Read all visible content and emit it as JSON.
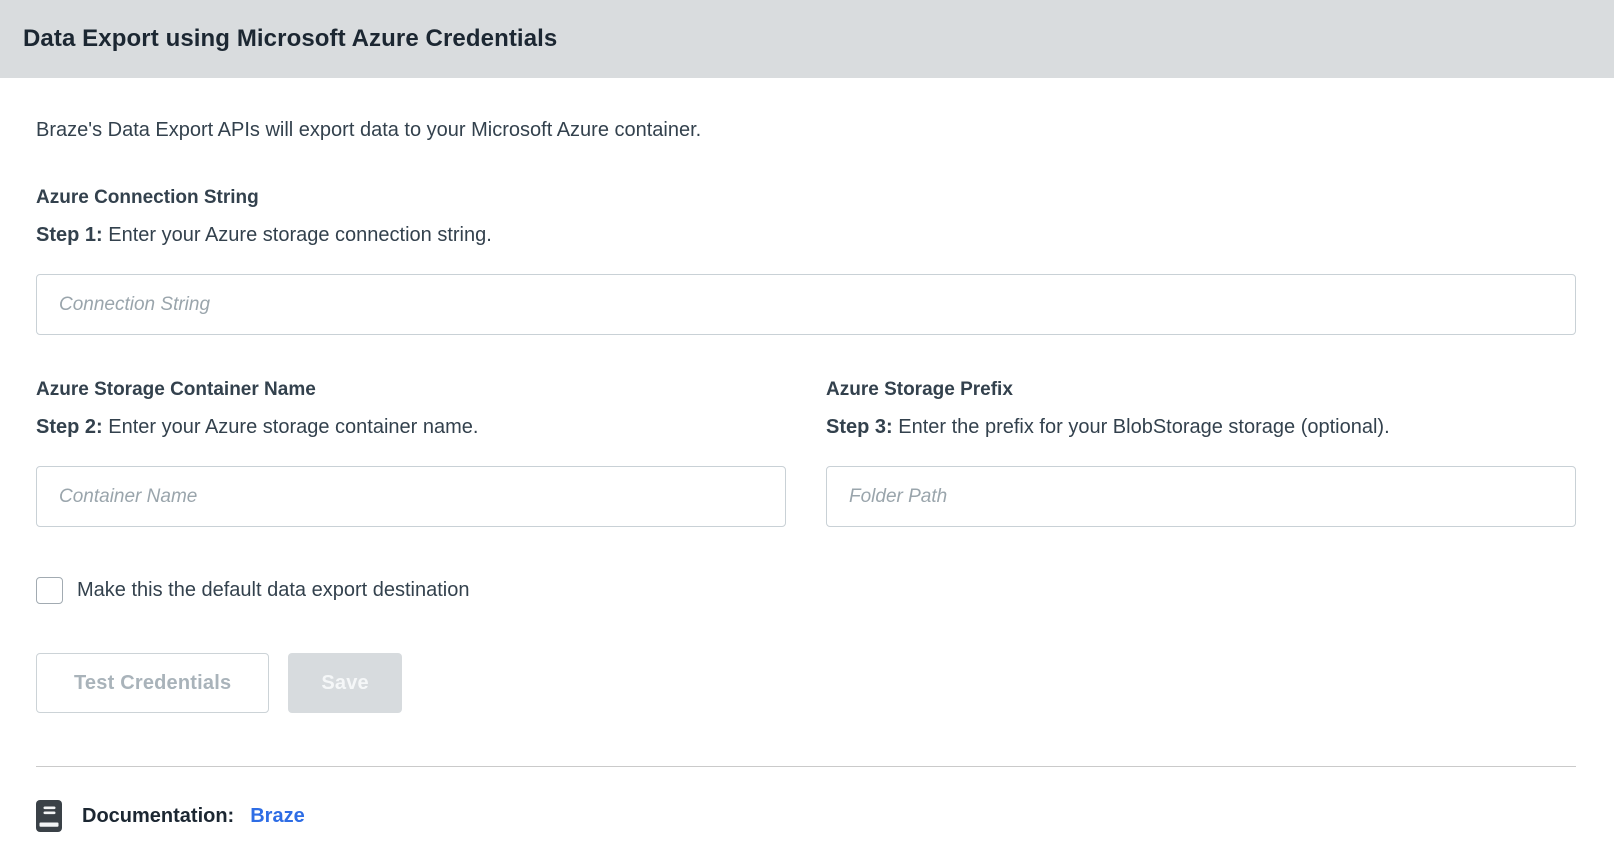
{
  "header": {
    "title": "Data Export using Microsoft Azure Credentials"
  },
  "intro": "Braze's Data Export APIs will export data to your Microsoft Azure container.",
  "fields": {
    "connection_string": {
      "heading": "Azure Connection String",
      "step_label": "Step 1:",
      "step_text": "Enter your Azure storage connection string.",
      "placeholder": "Connection String",
      "value": ""
    },
    "container_name": {
      "heading": "Azure Storage Container Name",
      "step_label": "Step 2:",
      "step_text": "Enter your Azure storage container name.",
      "placeholder": "Container Name",
      "value": ""
    },
    "storage_prefix": {
      "heading": "Azure Storage Prefix",
      "step_label": "Step 3:",
      "step_text": "Enter the prefix for your BlobStorage storage (optional).",
      "placeholder": "Folder Path",
      "value": ""
    }
  },
  "default_checkbox": {
    "label": "Make this the default data export destination",
    "checked": false
  },
  "buttons": {
    "test_label": "Test Credentials",
    "save_label": "Save"
  },
  "documentation": {
    "icon": "book-icon",
    "label": "Documentation:",
    "link_label": "Braze"
  },
  "colors": {
    "header_bg": "#d9dcde",
    "title_text": "#1c2732",
    "body_text": "#33414d",
    "placeholder_text": "#9aa5ac",
    "input_border": "#c9d1d6",
    "disabled_button_bg": "#d7dbde",
    "disabled_button_text": "#a9b3ba",
    "link_blue": "#2e6de5",
    "book_icon": "#3a4147"
  }
}
